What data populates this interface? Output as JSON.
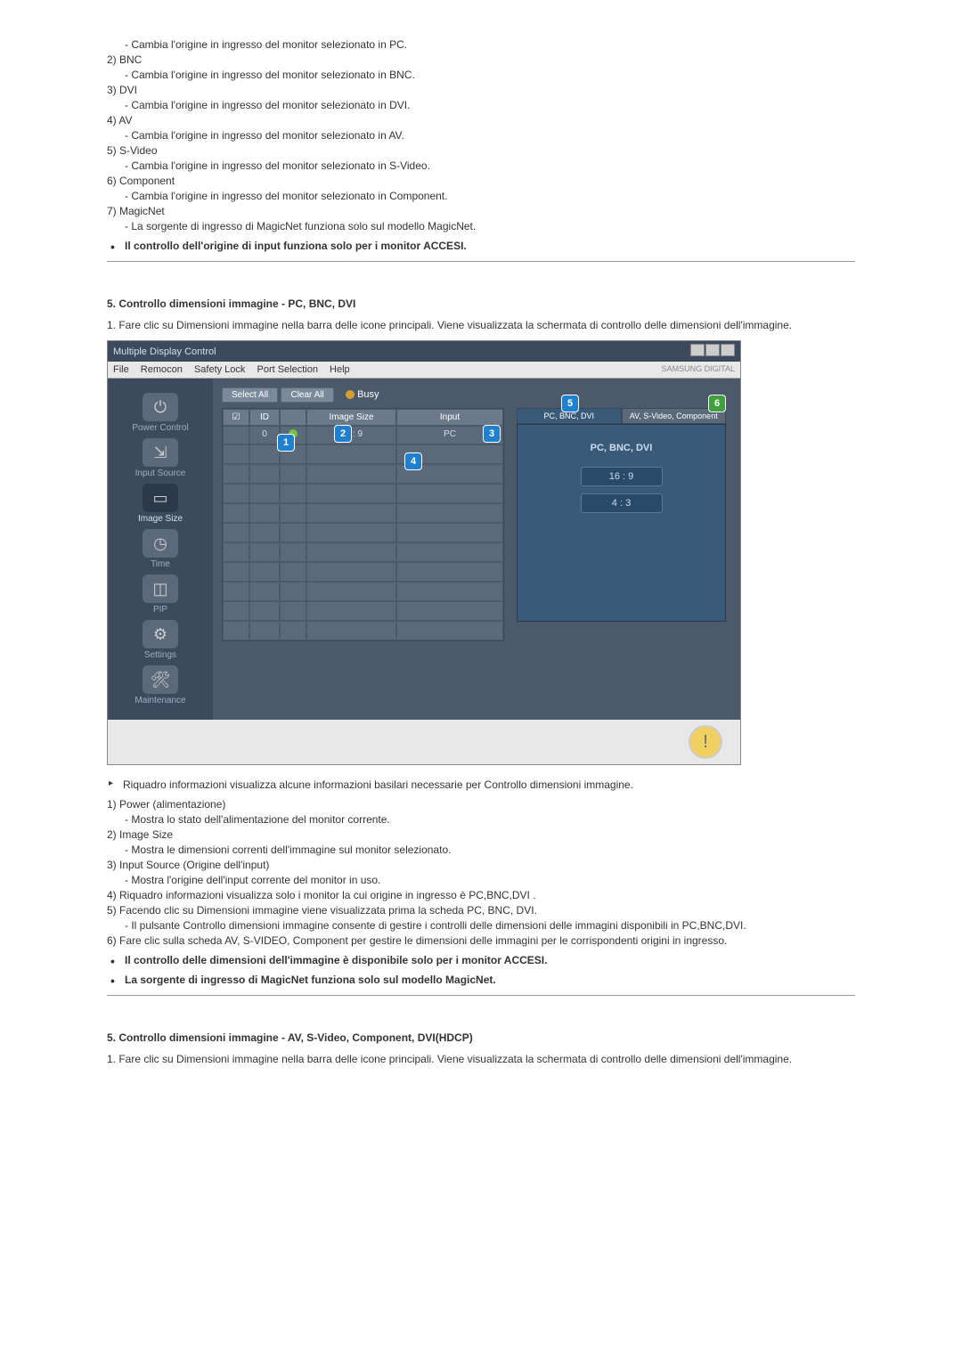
{
  "top_section": {
    "items": [
      {
        "sub": "- Cambia l'origine in ingresso del monitor selezionato in PC."
      },
      {
        "num": "2)",
        "label": "BNC",
        "sub": "- Cambia l'origine in ingresso del monitor selezionato in BNC."
      },
      {
        "num": "3)",
        "label": "DVI",
        "sub": "- Cambia l'origine in ingresso del monitor selezionato in DVI."
      },
      {
        "num": "4)",
        "label": "AV",
        "sub": "- Cambia l'origine in ingresso del monitor selezionato in AV."
      },
      {
        "num": "5)",
        "label": "S-Video",
        "sub": "- Cambia l'origine in ingresso del monitor selezionato in S-Video."
      },
      {
        "num": "6)",
        "label": "Component",
        "sub": "- Cambia l'origine in ingresso del monitor selezionato in Component."
      },
      {
        "num": "7)",
        "label": "MagicNet",
        "sub": "- La sorgente di ingresso di MagicNet funziona solo sul modello MagicNet."
      }
    ],
    "bullet": "Il controllo dell'origine di input funziona solo per i monitor ACCESI."
  },
  "section5a": {
    "title": "5. Controllo dimensioni immagine - PC, BNC, DVI",
    "step1": "1.  Fare clic su Dimensioni immagine nella barra delle icone principali. Viene visualizzata la schermata di controllo delle dimensioni dell'immagine."
  },
  "window": {
    "title": "Multiple Display Control",
    "menus": [
      "File",
      "Remocon",
      "Safety Lock",
      "Port Selection",
      "Help"
    ],
    "logo": "SAMSUNG DIGITAL",
    "sidebar": [
      {
        "label": "Power Control"
      },
      {
        "label": "Input Source"
      },
      {
        "label": "Image Size",
        "active": true
      },
      {
        "label": "Time"
      },
      {
        "label": "PIP"
      },
      {
        "label": "Settings"
      },
      {
        "label": "Maintenance"
      }
    ],
    "buttons": {
      "select_all": "Select All",
      "clear_all": "Clear All",
      "busy": "Busy"
    },
    "headers": {
      "chk": "☑",
      "id": "ID",
      "pw": "",
      "size": "Image Size",
      "input": "Input"
    },
    "row": {
      "chk": "",
      "id": "0",
      "pw": "on",
      "size": "16 : 9",
      "input": "PC"
    },
    "tabs": {
      "left": "PC, BNC, DVI",
      "right": "AV, S-Video, Component"
    },
    "panel": {
      "title": "PC, BNC, DVI",
      "opt1": "16 : 9",
      "opt2": "4 : 3"
    },
    "badges": {
      "b1": "1",
      "b2": "2",
      "b3": "3",
      "b4": "4",
      "b5": "5",
      "b6": "6"
    }
  },
  "mid_section": {
    "arrow": "Riquadro informazioni visualizza alcune informazioni basilari necessarie per Controllo dimensioni immagine.",
    "items": [
      {
        "num": "1)",
        "label": "Power (alimentazione)",
        "sub": "- Mostra lo stato dell'alimentazione del monitor corrente."
      },
      {
        "num": "2)",
        "label": "Image Size",
        "sub": "- Mostra le dimensioni correnti dell'immagine sul monitor selezionato."
      },
      {
        "num": "3)",
        "label": "Input Source (Origine dell'input)",
        "sub": "- Mostra l'origine dell'input corrente del monitor in uso."
      },
      {
        "num": "4)",
        "label": "Riquadro informazioni visualizza solo i monitor la cui origine in ingresso è PC,BNC,DVI ."
      },
      {
        "num": "5)",
        "label": "Facendo clic su Dimensioni immagine viene visualizzata prima la scheda PC, BNC, DVI.",
        "sub": "- Il pulsante Controllo dimensioni immagine consente di gestire i controlli delle dimensioni delle immagini disponibili in PC,BNC,DVI."
      },
      {
        "num": "6)",
        "label": "Fare clic sulla scheda AV, S-VIDEO, Component per gestire le dimensioni delle immagini per le corrispondenti origini in ingresso."
      }
    ],
    "bullets": [
      "Il controllo delle dimensioni dell'immagine è disponibile solo per i monitor ACCESI.",
      "La sorgente di ingresso di MagicNet funziona solo sul modello MagicNet."
    ]
  },
  "section5b": {
    "title": "5. Controllo dimensioni immagine - AV, S-Video, Component, DVI(HDCP)",
    "step1": "1.  Fare clic su Dimensioni immagine nella barra delle icone principali. Viene visualizzata la schermata di controllo delle dimensioni dell'immagine."
  }
}
